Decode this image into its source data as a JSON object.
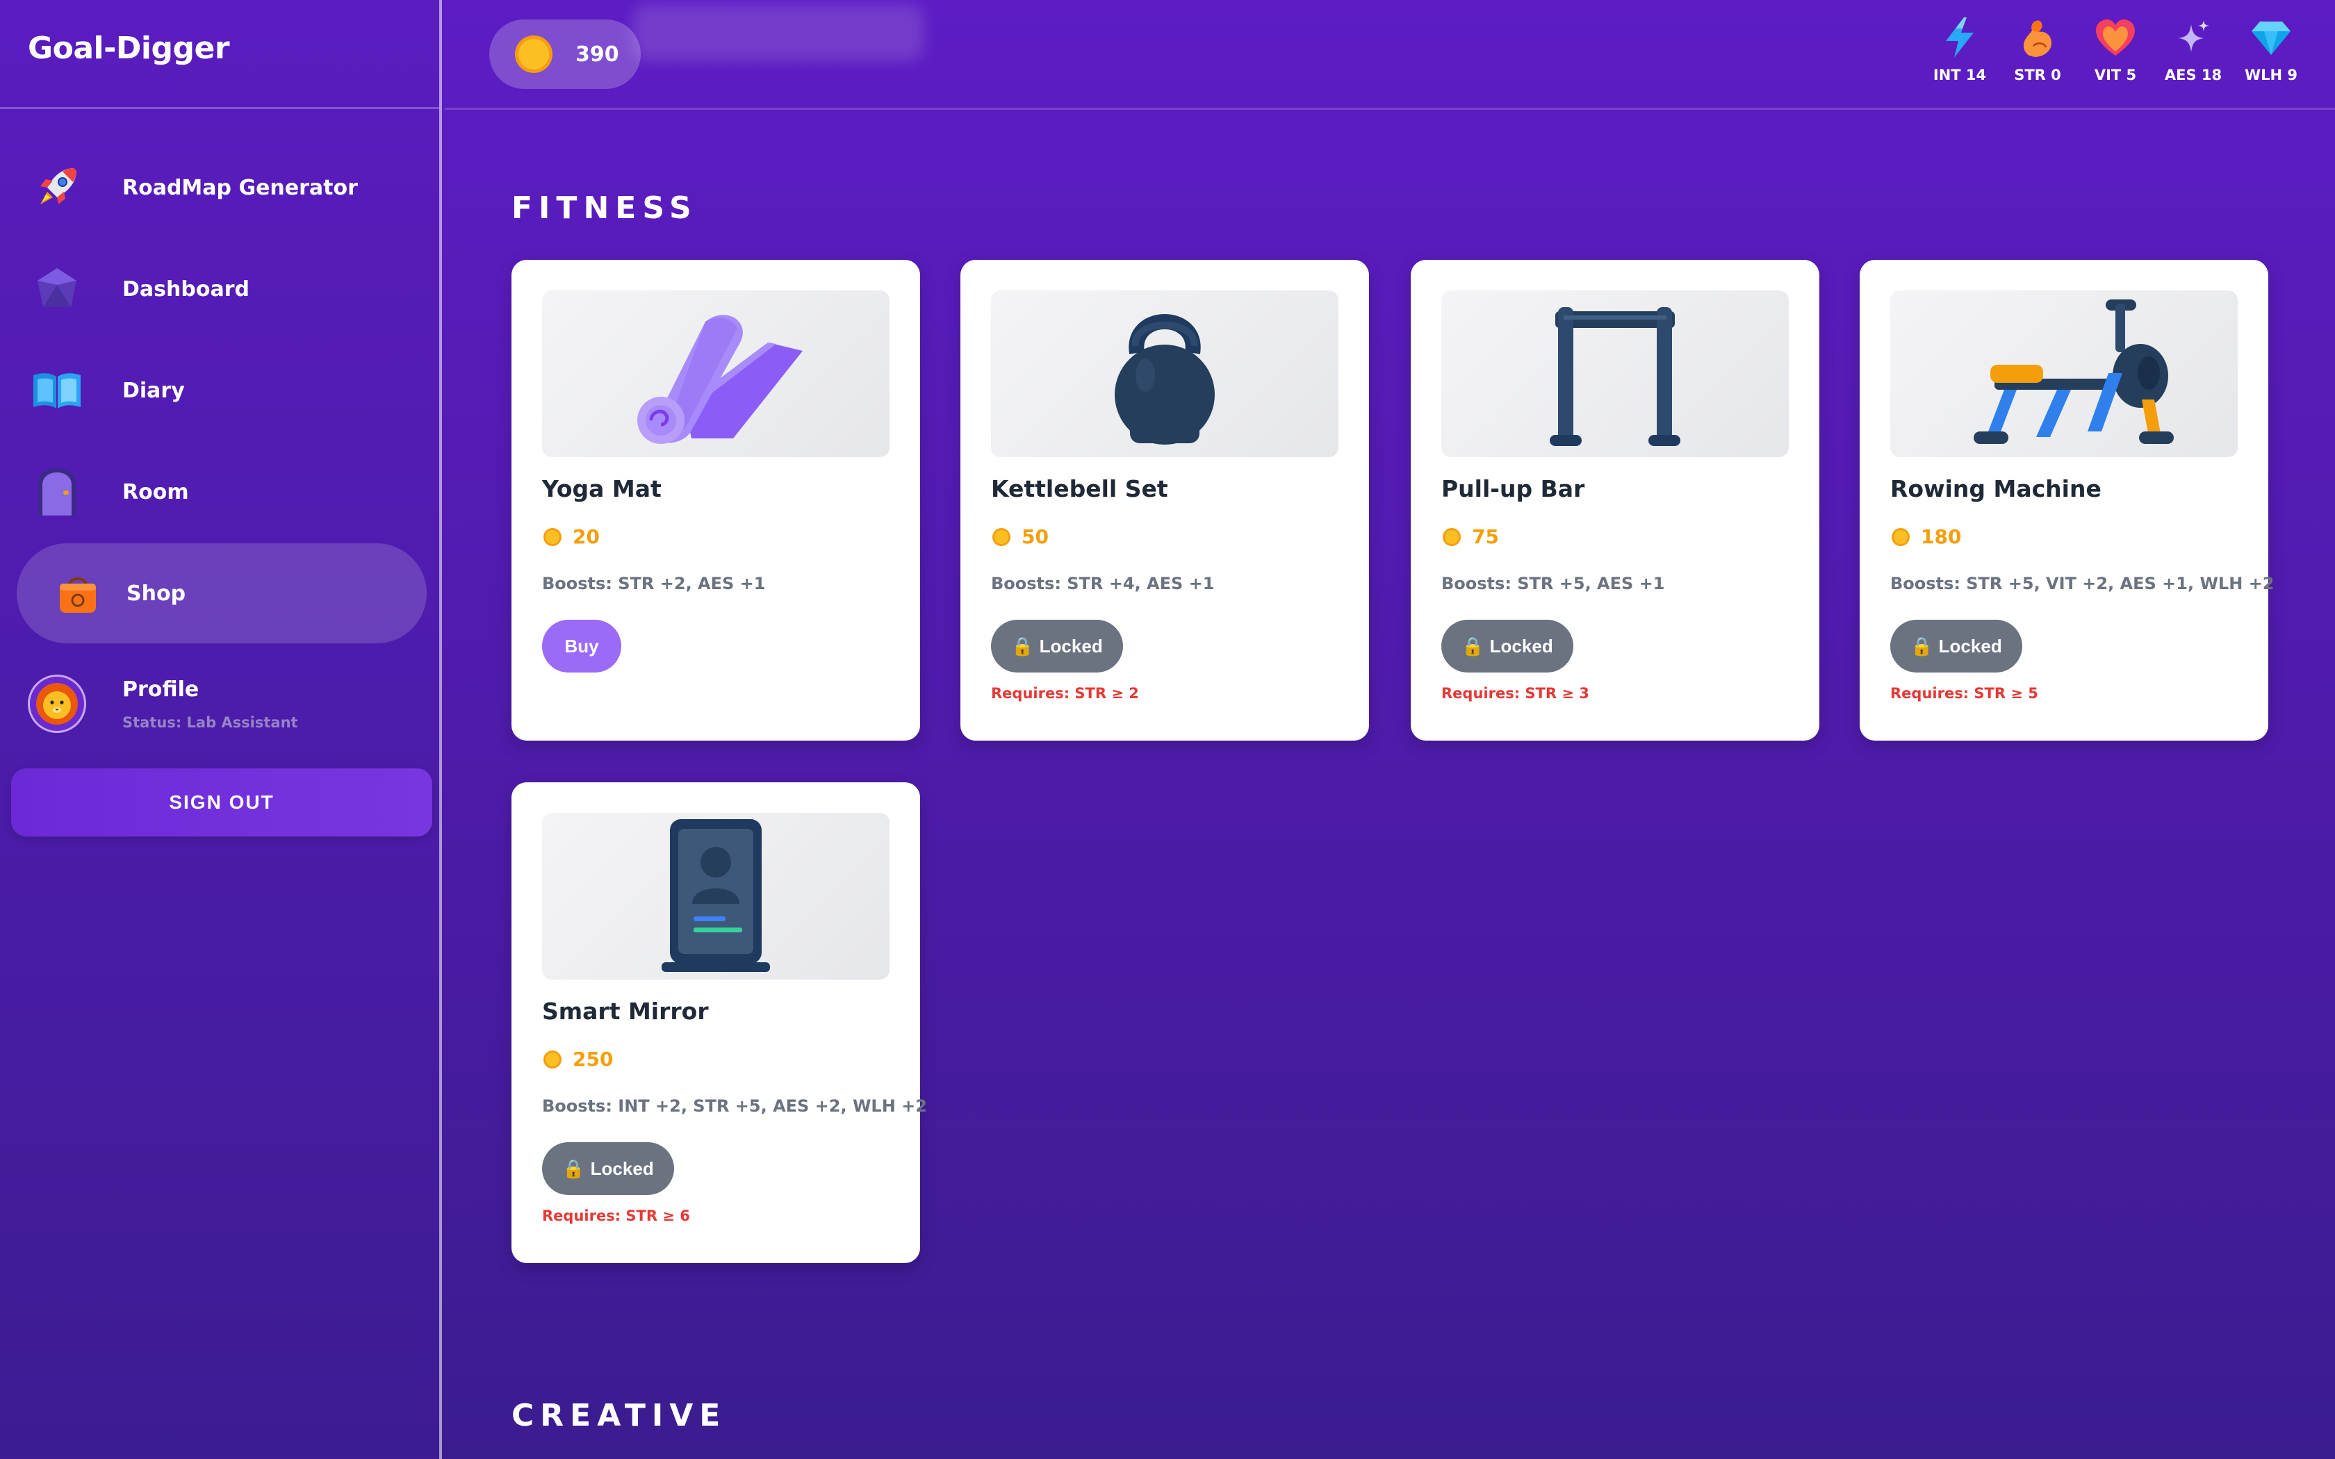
{
  "app": {
    "title": "Goal-Digger"
  },
  "sidebar": {
    "items": [
      {
        "label": "RoadMap Generator",
        "icon": "rocket-icon"
      },
      {
        "label": "Dashboard",
        "icon": "gem-icon"
      },
      {
        "label": "Diary",
        "icon": "book-icon"
      },
      {
        "label": "Room",
        "icon": "door-icon"
      },
      {
        "label": "Shop",
        "icon": "shopping-bag-icon",
        "active": true
      }
    ],
    "profile": {
      "label": "Profile",
      "status": "Status: Lab Assistant",
      "icon": "lion-icon"
    },
    "sign_out": "SIGN OUT"
  },
  "topbar": {
    "coins": "390",
    "stats": [
      {
        "label": "INT 14",
        "icon": "lightning-icon"
      },
      {
        "label": "STR 0",
        "icon": "flexed-arm-icon"
      },
      {
        "label": "VIT 5",
        "icon": "heart-icon"
      },
      {
        "label": "AES 18",
        "icon": "sparkle-icon"
      },
      {
        "label": "WLH 9",
        "icon": "diamond-icon"
      }
    ]
  },
  "sections": [
    {
      "title": "FITNESS",
      "items": [
        {
          "name": "Yoga Mat",
          "price": "20",
          "boosts": "Boosts: STR +2, AES +1",
          "action": "Buy",
          "icon": "yoga-mat-icon"
        },
        {
          "name": "Kettlebell Set",
          "price": "50",
          "boosts": "Boosts: STR +4, AES +1",
          "action": "Locked",
          "requires": "Requires: STR ≥ 2",
          "icon": "kettlebell-icon"
        },
        {
          "name": "Pull-up Bar",
          "price": "75",
          "boosts": "Boosts: STR +5, AES +1",
          "action": "Locked",
          "requires": "Requires: STR ≥ 3",
          "icon": "pull-up-bar-icon"
        },
        {
          "name": "Rowing Machine",
          "price": "180",
          "boosts": "Boosts: STR +5, VIT +2, AES +1, WLH +2",
          "action": "Locked",
          "requires": "Requires: STR ≥ 5",
          "icon": "rowing-machine-icon"
        },
        {
          "name": "Smart Mirror",
          "price": "250",
          "boosts": "Boosts: INT +2, STR +5, AES +2, WLH +2",
          "action": "Locked",
          "requires": "Requires: STR ≥ 6",
          "icon": "smart-mirror-icon"
        }
      ]
    },
    {
      "title": "CREATIVE"
    }
  ],
  "colors": {
    "background": "#5d1cc4",
    "card": "#ffffff",
    "buy": "#9b6af7",
    "locked": "#6b7280",
    "price": "#f59e0b",
    "requires": "#e53935"
  }
}
